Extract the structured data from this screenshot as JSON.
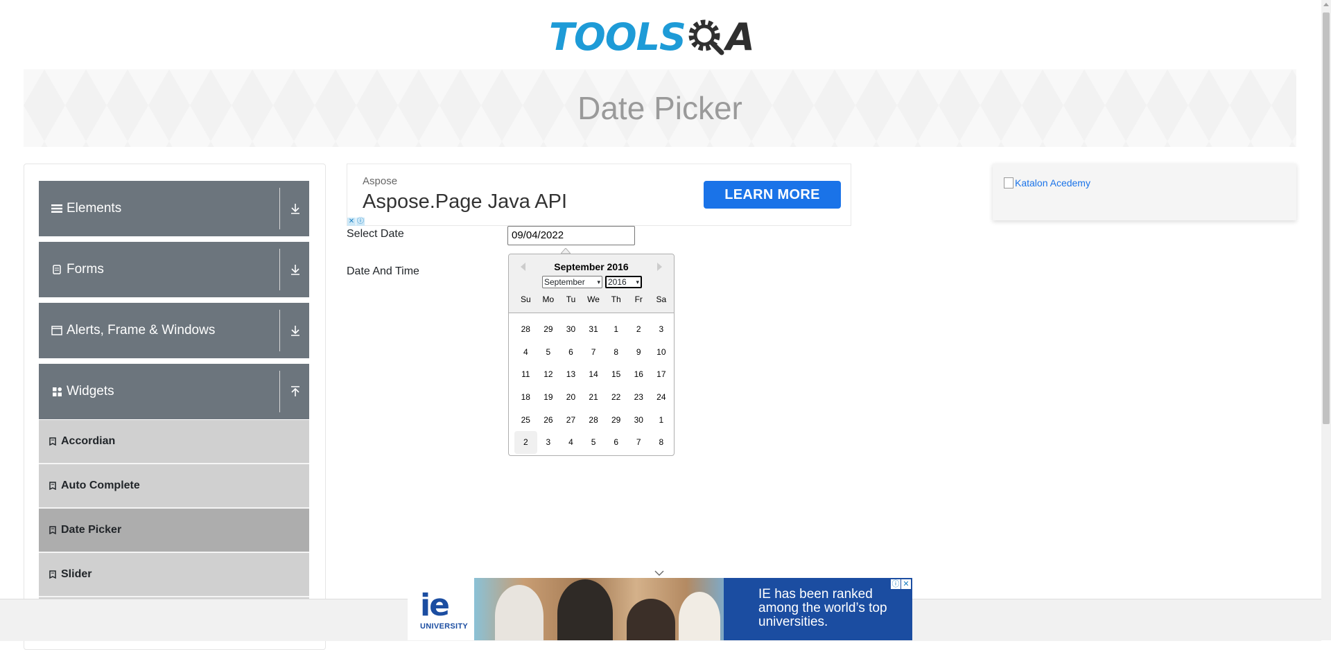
{
  "logo": {
    "left": "TOOLS",
    "right": "A"
  },
  "banner": {
    "title": "Date Picker"
  },
  "sidebar": {
    "groups": [
      {
        "label": "Elements"
      },
      {
        "label": "Forms"
      },
      {
        "label": "Alerts, Frame & Windows"
      },
      {
        "label": "Widgets"
      }
    ],
    "widget_items": [
      {
        "label": "Accordian"
      },
      {
        "label": "Auto Complete"
      },
      {
        "label": "Date Picker"
      },
      {
        "label": "Slider"
      }
    ]
  },
  "ad_top": {
    "brand": "Aspose",
    "headline": "Aspose.Page Java API",
    "button": "LEARN MORE"
  },
  "form": {
    "select_date_label": "Select Date",
    "select_date_value": "09/04/2022",
    "date_time_label": "Date And Time"
  },
  "calendar": {
    "title": "September 2016",
    "month_select": "September",
    "year_select": "2016",
    "weekdays": [
      "Su",
      "Mo",
      "Tu",
      "We",
      "Th",
      "Fr",
      "Sa"
    ],
    "days": [
      "28",
      "29",
      "30",
      "31",
      "1",
      "2",
      "3",
      "4",
      "5",
      "6",
      "7",
      "8",
      "9",
      "10",
      "11",
      "12",
      "13",
      "14",
      "15",
      "16",
      "17",
      "18",
      "19",
      "20",
      "21",
      "22",
      "23",
      "24",
      "25",
      "26",
      "27",
      "28",
      "29",
      "30",
      "1",
      "2",
      "3",
      "4",
      "5",
      "6",
      "7",
      "8"
    ],
    "highlighted_index": 35
  },
  "ad_right": {
    "alt_text": "Katalon Acedemy"
  },
  "ad_bottom": {
    "logo_big": "ie",
    "logo_small": "UNIVERSITY",
    "text": "IE has been ranked among the world’s top universities."
  },
  "colors": {
    "sidebar_header": "#6c757d",
    "menu_item": "#d0d0d0",
    "menu_item_active": "#adadad",
    "logo_blue": "#1e9bd7",
    "ad_button": "#1a73e8"
  }
}
